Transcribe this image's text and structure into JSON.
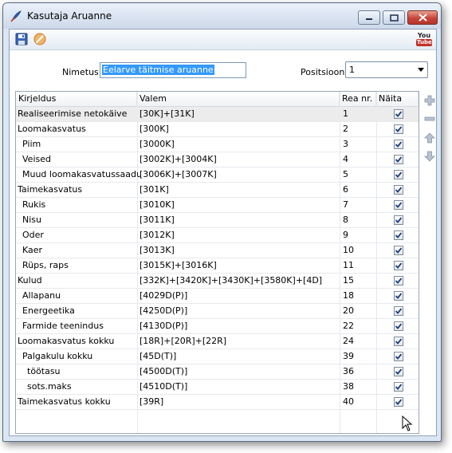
{
  "window": {
    "title": "Kasutaja Aruanne"
  },
  "toolbar": {
    "youtube_top": "You",
    "youtube_bottom": "Tube"
  },
  "form": {
    "nimetus_label": "Nimetus:",
    "nimetus_value": "Eelarve täitmise aruanne",
    "positsioon_label": "Positsioon:",
    "positsioon_value": "1"
  },
  "grid": {
    "columns": {
      "kirjeldus": "Kirjeldus",
      "valem": "Valem",
      "rea_nr": "Rea nr.",
      "naita": "Näita"
    },
    "rows": [
      {
        "kirjeldus": "Realiseerimise netokäive",
        "valem": "[30K]+[31K]",
        "rea_nr": "1",
        "naita": true,
        "indent": 0
      },
      {
        "kirjeldus": "Loomakasvatus",
        "valem": "[300K]",
        "rea_nr": "2",
        "naita": true,
        "indent": 0
      },
      {
        "kirjeldus": "Piim",
        "valem": "[3000K]",
        "rea_nr": "3",
        "naita": true,
        "indent": 1
      },
      {
        "kirjeldus": "Veised",
        "valem": "[3002K]+[3004K]",
        "rea_nr": "4",
        "naita": true,
        "indent": 1
      },
      {
        "kirjeldus": "Muud loomakasvatussaaduse",
        "valem": "[3006K]+[3007K]",
        "rea_nr": "5",
        "naita": true,
        "indent": 1
      },
      {
        "kirjeldus": "Taimekasvatus",
        "valem": "[301K]",
        "rea_nr": "6",
        "naita": true,
        "indent": 0
      },
      {
        "kirjeldus": "Rukis",
        "valem": "[3010K]",
        "rea_nr": "7",
        "naita": true,
        "indent": 1
      },
      {
        "kirjeldus": "Nisu",
        "valem": "[3011K]",
        "rea_nr": "8",
        "naita": true,
        "indent": 1
      },
      {
        "kirjeldus": "Oder",
        "valem": "[3012K]",
        "rea_nr": "9",
        "naita": true,
        "indent": 1
      },
      {
        "kirjeldus": "Kaer",
        "valem": "[3013K]",
        "rea_nr": "10",
        "naita": true,
        "indent": 1
      },
      {
        "kirjeldus": "Rüps, raps",
        "valem": "[3015K]+[3016K]",
        "rea_nr": "11",
        "naita": true,
        "indent": 1
      },
      {
        "kirjeldus": "Kulud",
        "valem": "[332K]+[3420K]+[3430K]+[3580K]+[4D]",
        "rea_nr": "15",
        "naita": true,
        "indent": 0
      },
      {
        "kirjeldus": "Allapanu",
        "valem": "[4029D(P)]",
        "rea_nr": "18",
        "naita": true,
        "indent": 1
      },
      {
        "kirjeldus": "Energeetika",
        "valem": "[4250D(P)]",
        "rea_nr": "20",
        "naita": true,
        "indent": 1
      },
      {
        "kirjeldus": "Farmide teenindus",
        "valem": "[4130D(P)]",
        "rea_nr": "22",
        "naita": true,
        "indent": 1
      },
      {
        "kirjeldus": "Loomakasvatus kokku",
        "valem": "[18R]+[20R]+[22R]",
        "rea_nr": "24",
        "naita": true,
        "indent": 0
      },
      {
        "kirjeldus": "Palgakulu  kokku",
        "valem": "[45D(T)]",
        "rea_nr": "39",
        "naita": true,
        "indent": 1
      },
      {
        "kirjeldus": "töötasu",
        "valem": "[4500D(T)]",
        "rea_nr": "36",
        "naita": true,
        "indent": 2
      },
      {
        "kirjeldus": "sots.maks",
        "valem": "[4510D(T)]",
        "rea_nr": "38",
        "naita": true,
        "indent": 2
      },
      {
        "kirjeldus": "Taimekasvatus kokku",
        "valem": "[39R]",
        "rea_nr": "40",
        "naita": true,
        "indent": 0
      }
    ]
  },
  "colors": {
    "accent": "#3399ff",
    "add": "#8aa0b8",
    "title_bar": "#cdd9ea"
  }
}
